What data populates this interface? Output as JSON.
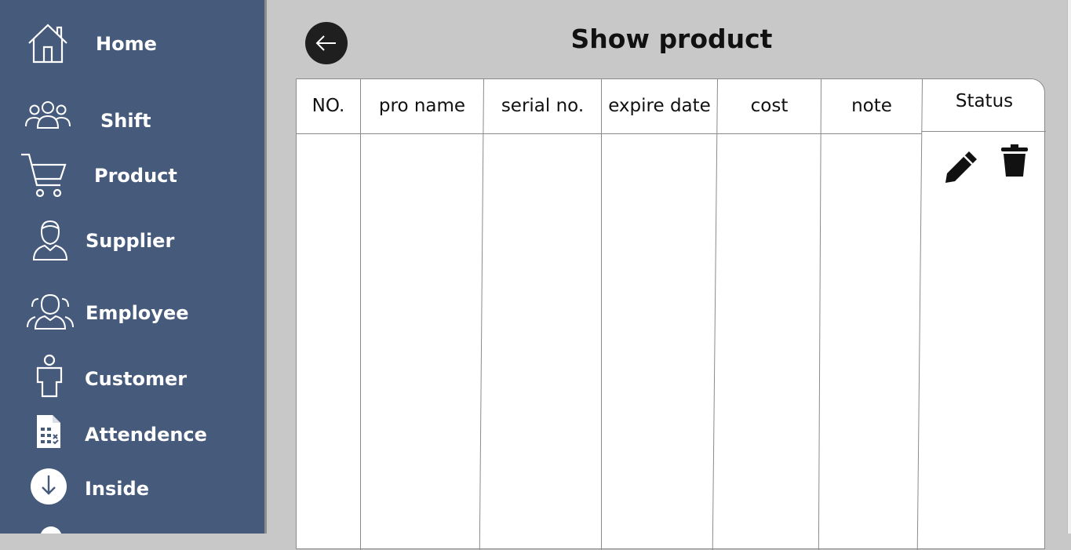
{
  "sidebar": {
    "items": [
      {
        "label": "Home",
        "icon": "home-icon"
      },
      {
        "label": "Shift",
        "icon": "group-icon"
      },
      {
        "label": "Product",
        "icon": "cart-icon"
      },
      {
        "label": "Supplier",
        "icon": "person-icon"
      },
      {
        "label": "Employee",
        "icon": "people-icon"
      },
      {
        "label": "Customer",
        "icon": "customer-icon"
      },
      {
        "label": "Attendence",
        "icon": "document-icon"
      },
      {
        "label": "Inside",
        "icon": "arrow-down-circle-icon"
      }
    ]
  },
  "header": {
    "title": "Show product",
    "back_icon": "arrow-left-icon"
  },
  "table": {
    "columns": [
      "NO.",
      "pro name",
      "serial no.",
      "expire date",
      "cost",
      "note",
      "Status"
    ],
    "row_actions": {
      "edit_icon": "pencil-icon",
      "delete_icon": "trash-icon"
    }
  },
  "colors": {
    "sidebar": "#465a7b",
    "background": "#c8c8c8",
    "panel": "#ffffff",
    "text": "#111111"
  }
}
